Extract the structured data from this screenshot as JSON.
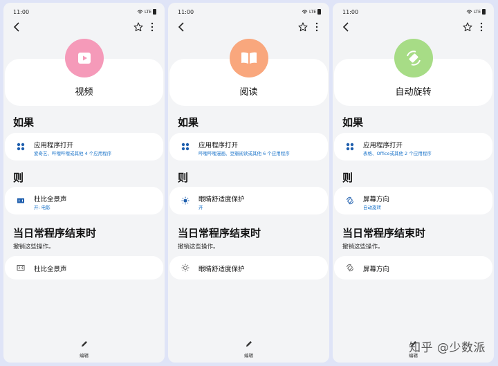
{
  "screens": [
    {
      "status_time": "11:00",
      "status_network": "LTE",
      "hero_title": "视频",
      "hero_icon": "play-icon",
      "hero_color": "#f59ab9",
      "if_header": "如果",
      "trigger_title": "应用程序打开",
      "trigger_sub": "爱奇艺、哔哩哔哩或其他 4 个应用程序",
      "then_header": "则",
      "action_title": "杜比全景声",
      "action_sub": "开: 电影",
      "action_icon": "dolby-icon",
      "end_header": "当日常程序结束时",
      "end_sub": "撤销这些操作。",
      "end_title": "杜比全景声",
      "edit_label": "编辑"
    },
    {
      "status_time": "11:00",
      "status_network": "LTE",
      "hero_title": "阅读",
      "hero_icon": "book-icon",
      "hero_color": "#f9a77d",
      "if_header": "如果",
      "trigger_title": "应用程序打开",
      "trigger_sub": "哔哩哔哩漫画、豆瓣阅读或其他 6 个应用程序",
      "then_header": "则",
      "action_title": "眼睛舒适度保护",
      "action_sub": "开",
      "action_icon": "sun-icon",
      "end_header": "当日常程序结束时",
      "end_sub": "撤销这些操作。",
      "end_title": "眼睛舒适度保护",
      "edit_label": "编辑"
    },
    {
      "status_time": "11:00",
      "status_network": "LTE",
      "hero_title": "自动旋转",
      "hero_icon": "rotate-icon",
      "hero_color": "#a7dc86",
      "if_header": "如果",
      "trigger_title": "应用程序打开",
      "trigger_sub": "表格、Office或其他 2 个应用程序",
      "then_header": "则",
      "action_title": "屏幕方向",
      "action_sub": "自动旋转",
      "action_icon": "rotate-icon",
      "end_header": "当日常程序结束时",
      "end_sub": "撤销这些操作。",
      "end_title": "屏幕方向",
      "edit_label": "编辑"
    }
  ],
  "watermark": "知乎 @少数派"
}
